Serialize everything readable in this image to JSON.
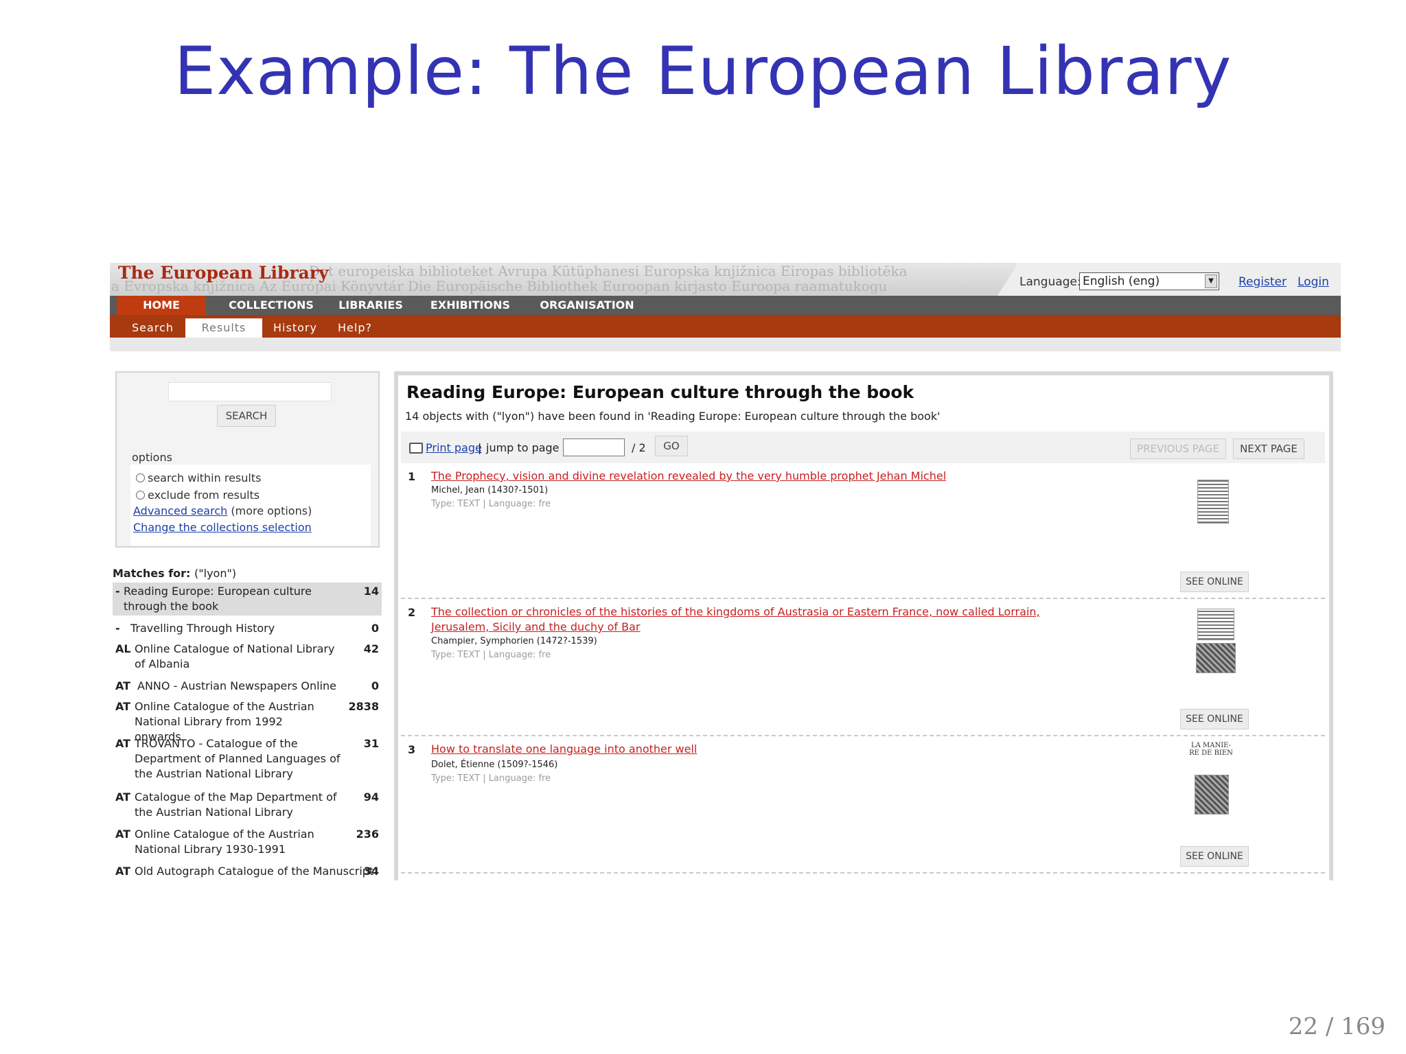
{
  "slide": {
    "title": "Example: The European Library",
    "page_number": "22 / 169"
  },
  "header": {
    "brand": "The European Library",
    "ghost_line1": "Det europeiska biblioteket  Avrupa Kütüphanesi Europska knjižnica Eiropas bibliotēka",
    "ghost_line2": "a  Evropska knjižnica  Az Európai Könyvtár  Die Europäische Bibliothek  Euroopan kirjasto Euroopa raamatukogu",
    "language_label": "Language:",
    "language_value": "English (eng)",
    "register": "Register",
    "login": "Login"
  },
  "main_nav": [
    "HOME",
    "COLLECTIONS",
    "LIBRARIES",
    "EXHIBITIONS",
    "ORGANISATION"
  ],
  "sub_nav": [
    "Search",
    "Results",
    "History",
    "Help?"
  ],
  "search_panel": {
    "button": "SEARCH",
    "options_label": "options",
    "option_within": "search within results",
    "option_exclude": "exclude from results",
    "advanced_link": "Advanced search",
    "advanced_suffix": "(more options)",
    "change_link": "Change the collections selection"
  },
  "matches": {
    "label": "Matches for:",
    "query": "(\"lyon\")",
    "rows": [
      {
        "code": "-",
        "name": "Reading Europe: European culture through the book",
        "count": "14"
      },
      {
        "code": "-",
        "name": "Travelling Through History",
        "count": "0"
      },
      {
        "code": "AL",
        "name": "Online Catalogue of National Library of Albania",
        "count": "42"
      },
      {
        "code": "AT",
        "name": "ANNO - Austrian Newspapers Online",
        "count": "0"
      },
      {
        "code": "AT",
        "name": "Online Catalogue of the Austrian National Library from 1992 onwards",
        "count": "2838"
      },
      {
        "code": "AT",
        "name": "TROVANTO - Catalogue of the Department of Planned Languages of the Austrian National Library",
        "count": "31"
      },
      {
        "code": "AT",
        "name": "Catalogue of the Map Department of the Austrian National Library",
        "count": "94"
      },
      {
        "code": "AT",
        "name": "Online Catalogue of the Austrian National Library 1930-1991",
        "count": "236"
      },
      {
        "code": "AT",
        "name": "Old Autograph Catalogue of the Manuscript",
        "count": "34"
      }
    ]
  },
  "results": {
    "title": "Reading Europe: European culture through the book",
    "summary": "14 objects with (\"lyon\") have been found in 'Reading Europe: European culture through the book'",
    "print": "Print page",
    "separator": "|",
    "jump": "jump to page",
    "total_pages": "/ 2",
    "go": "GO",
    "previous": "PREVIOUS PAGE",
    "next": "NEXT PAGE",
    "see_online": "SEE ONLINE",
    "items": [
      {
        "num": "1",
        "title": "The Prophecy, vision and divine revelation revealed by the very humble prophet Jehan Michel",
        "author": "Michel, Jean (1430?-1501)",
        "meta": "Type: TEXT  |  Language: fre"
      },
      {
        "num": "2",
        "title": "The collection or chronicles of the histories of the kingdoms of Austrasia or Eastern France, now called Lorrain, Jerusalem, Sicily and the duchy of Bar",
        "author": "Champier, Symphorien (1472?-1539)",
        "meta": "Type: TEXT  |  Language: fre"
      },
      {
        "num": "3",
        "title": "How to translate one language into another well",
        "author": "Dolet, Étienne (1509?-1546)",
        "meta": "Type: TEXT  |  Language: fre"
      }
    ],
    "thumb3_text": "LA MANIE-\nRE DE BIEN"
  }
}
